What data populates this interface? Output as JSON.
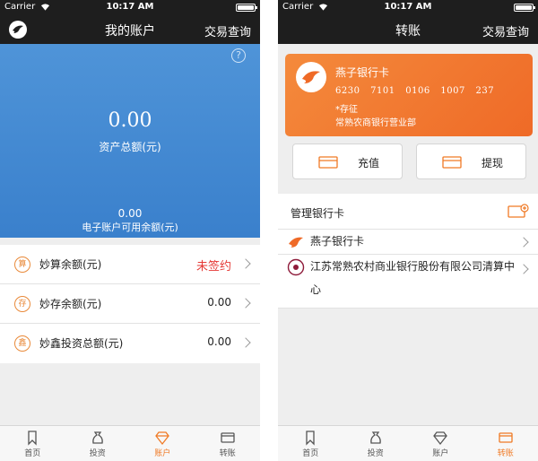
{
  "left": {
    "status": {
      "carrier": "Carrier",
      "time": "10:17 AM"
    },
    "nav": {
      "title": "我的账户",
      "right": "交易查询",
      "logo_icon": "swallow-logo-icon"
    },
    "asset": {
      "help": "?",
      "value": "0.00",
      "label": "资产总额(元)",
      "avail_value": "0.00",
      "avail_label": "电子账户可用余额(元)"
    },
    "accounts": [
      {
        "badge": "算",
        "name": "妙算余额(元)",
        "value": "未签约"
      },
      {
        "badge": "存",
        "name": "妙存余额(元)",
        "value": "0.00"
      },
      {
        "badge": "鑫",
        "name": "妙鑫投资总额(元)",
        "value": "0.00"
      }
    ],
    "tabs": [
      {
        "label": "首页",
        "icon": "bookmark-icon"
      },
      {
        "label": "投资",
        "icon": "money-bag-icon"
      },
      {
        "label": "账户",
        "icon": "diamond-icon"
      },
      {
        "label": "转账",
        "icon": "card-icon"
      }
    ],
    "active_tab": 2
  },
  "right": {
    "status": {
      "carrier": "Carrier",
      "time": "10:17 AM"
    },
    "nav": {
      "title": "转账",
      "right": "交易查询"
    },
    "card": {
      "name": "燕子银行卡",
      "number": "6230 7101 0106 1007 237",
      "holder": "*存征",
      "branch": "常熟农商银行营业部"
    },
    "actions": {
      "recharge": "充值",
      "withdraw": "提现"
    },
    "manage": {
      "title": "管理银行卡",
      "banks": [
        {
          "name": "燕子银行卡",
          "icon": "swallow-bank-icon"
        },
        {
          "name": "江苏常熟农村商业银行股份有限公司清算中心",
          "icon": "rural-bank-icon"
        }
      ]
    },
    "tabs": [
      {
        "label": "首页",
        "icon": "bookmark-icon"
      },
      {
        "label": "投资",
        "icon": "money-bag-icon"
      },
      {
        "label": "账户",
        "icon": "diamond-icon"
      },
      {
        "label": "转账",
        "icon": "card-icon"
      }
    ],
    "active_tab": 3
  },
  "colors": {
    "nav_bg": "#1e1e1e",
    "asset_blue": "#3a80cc",
    "accent_orange": "#f07a25",
    "alert_red": "#e53935"
  }
}
